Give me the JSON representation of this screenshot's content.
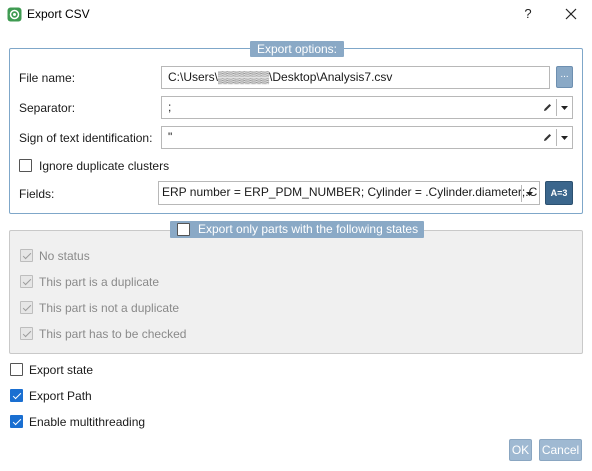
{
  "window": {
    "title": "Export CSV",
    "help": "?",
    "app_icon": "gear-badge-icon",
    "close_icon": "close-icon"
  },
  "export_options": {
    "title": "Export options:",
    "file_name_label": "File name:",
    "file_name_value": "C:\\Users\\▒▒▒▒▒▒\\Desktop\\Analysis7.csv",
    "browse_label": "...",
    "separator_label": "Separator:",
    "separator_value": ";",
    "text_id_label": "Sign of text identification:",
    "text_id_value": "\"",
    "ignore_duplicates_label": "Ignore duplicate clusters",
    "ignore_duplicates_checked": false,
    "fields_label": "Fields:",
    "fields_value": "ERP number = ERP_PDM_NUMBER; Cylinder = .Cylinder.diameter;.C",
    "fields_button": "A=3"
  },
  "states_group": {
    "title": "Export only parts with the following states",
    "enabled": false,
    "items": [
      {
        "label": "No status",
        "checked": true
      },
      {
        "label": "This part is a duplicate",
        "checked": true
      },
      {
        "label": "This part is not a duplicate",
        "checked": true
      },
      {
        "label": "This part has to be checked",
        "checked": true
      }
    ]
  },
  "options": {
    "export_state_label": "Export state",
    "export_state_checked": false,
    "export_path_label": "Export Path",
    "export_path_checked": true,
    "multithreading_label": "Enable multithreading",
    "multithreading_checked": true
  },
  "buttons": {
    "ok": "OK",
    "cancel": "Cancel"
  },
  "colors": {
    "accent": "#8aa9c6",
    "checkbox_checked": "#1a6fd1",
    "group_border": "#7fa7c9"
  }
}
